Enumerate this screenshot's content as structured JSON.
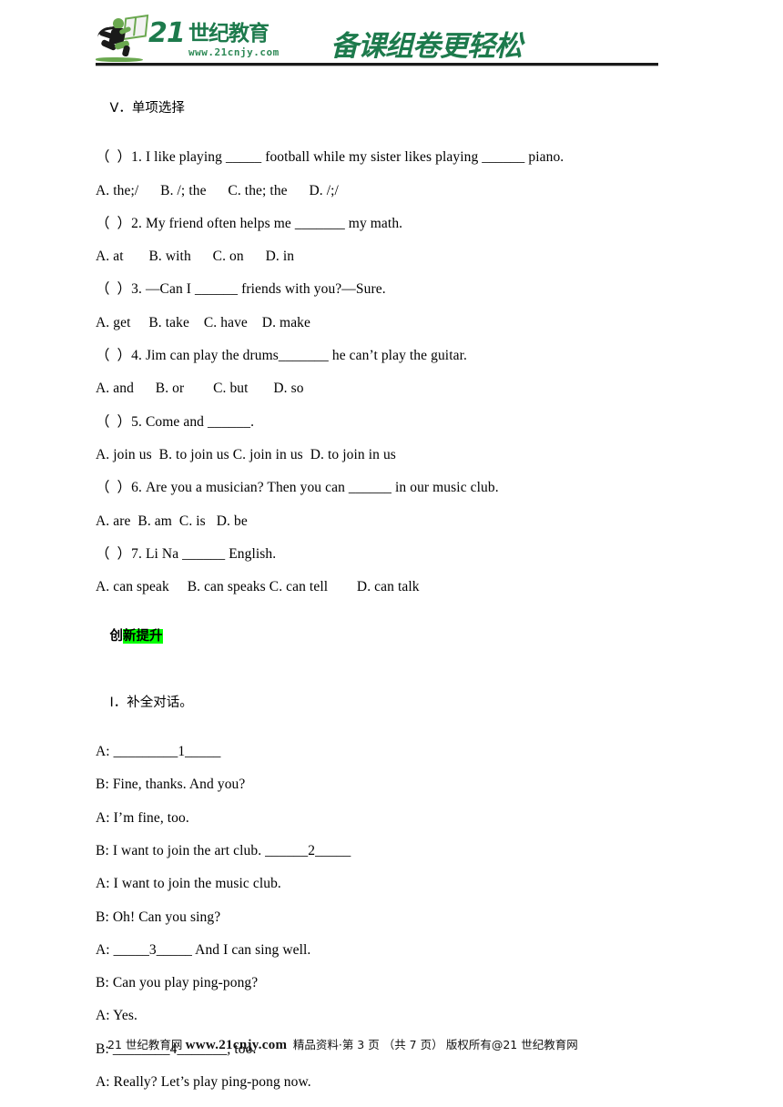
{
  "header": {
    "logo_number": "21",
    "logo_cn": "世纪教育",
    "logo_url": "www.21cnjy.com",
    "slogan": "备课组卷更轻松",
    "icons": {
      "runner": "running-person-icon",
      "book": "open-book-icon"
    },
    "brand_green": "#1d7a4c",
    "accent_green": "#6aa84f"
  },
  "sections": {
    "multiple_choice_heading": "Ⅴ．单项选择",
    "innovation_heading_plain": "创",
    "innovation_heading_highlight": "新提升",
    "highlight_color": "#00ff00",
    "dialogue_heading": "Ⅰ．补全对话。"
  },
  "questions": [
    {
      "stem": "（  ）1. I like playing _____ football while my sister likes playing ______ piano.",
      "options": "A. the;/      B. /; the      C. the; the      D. /;/"
    },
    {
      "stem": "（  ）2. My friend often helps me _______ my math.",
      "options": "A. at       B. with      C. on      D. in"
    },
    {
      "stem": "（  ）3. —Can I ______ friends with you?—Sure.",
      "options": "A. get     B. take    C. have    D. make"
    },
    {
      "stem": "（  ）4. Jim can play the drums_______ he can’t play the guitar.",
      "options": "A. and      B. or        C. but       D. so"
    },
    {
      "stem": "（  ）5. Come and ______.",
      "options": "A. join us  B. to join us C. join in us  D. to join in us"
    },
    {
      "stem": "（  ）6. Are you a musician? Then you can ______ in our music club.",
      "options": "A. are  B. am  C. is   D. be"
    },
    {
      "stem": "（  ）7. Li Na ______ English.",
      "options": "A. can speak     B. can speaks C. can tell        D. can talk"
    }
  ],
  "dialogue": [
    "A: _________1_____",
    "B: Fine, thanks. And you?",
    "A: I’m fine, too.",
    "B: I want to join the art club. ______2_____",
    "A: I want to join the music club.",
    "B: Oh! Can you sing?",
    "A: _____3_____ And I can sing well.",
    "B: Can you play ping-pong?",
    "A: Yes.",
    "B: ________4_______, too.",
    "A: Really? Let’s play ping-pong now."
  ],
  "footer": {
    "site_name": "21 世纪教育网",
    "site_url": "www.21cnjy.com",
    "note": "精品资料·第 3 页 （共 7 页）",
    "copyright": "版权所有@21 世纪教育网"
  }
}
